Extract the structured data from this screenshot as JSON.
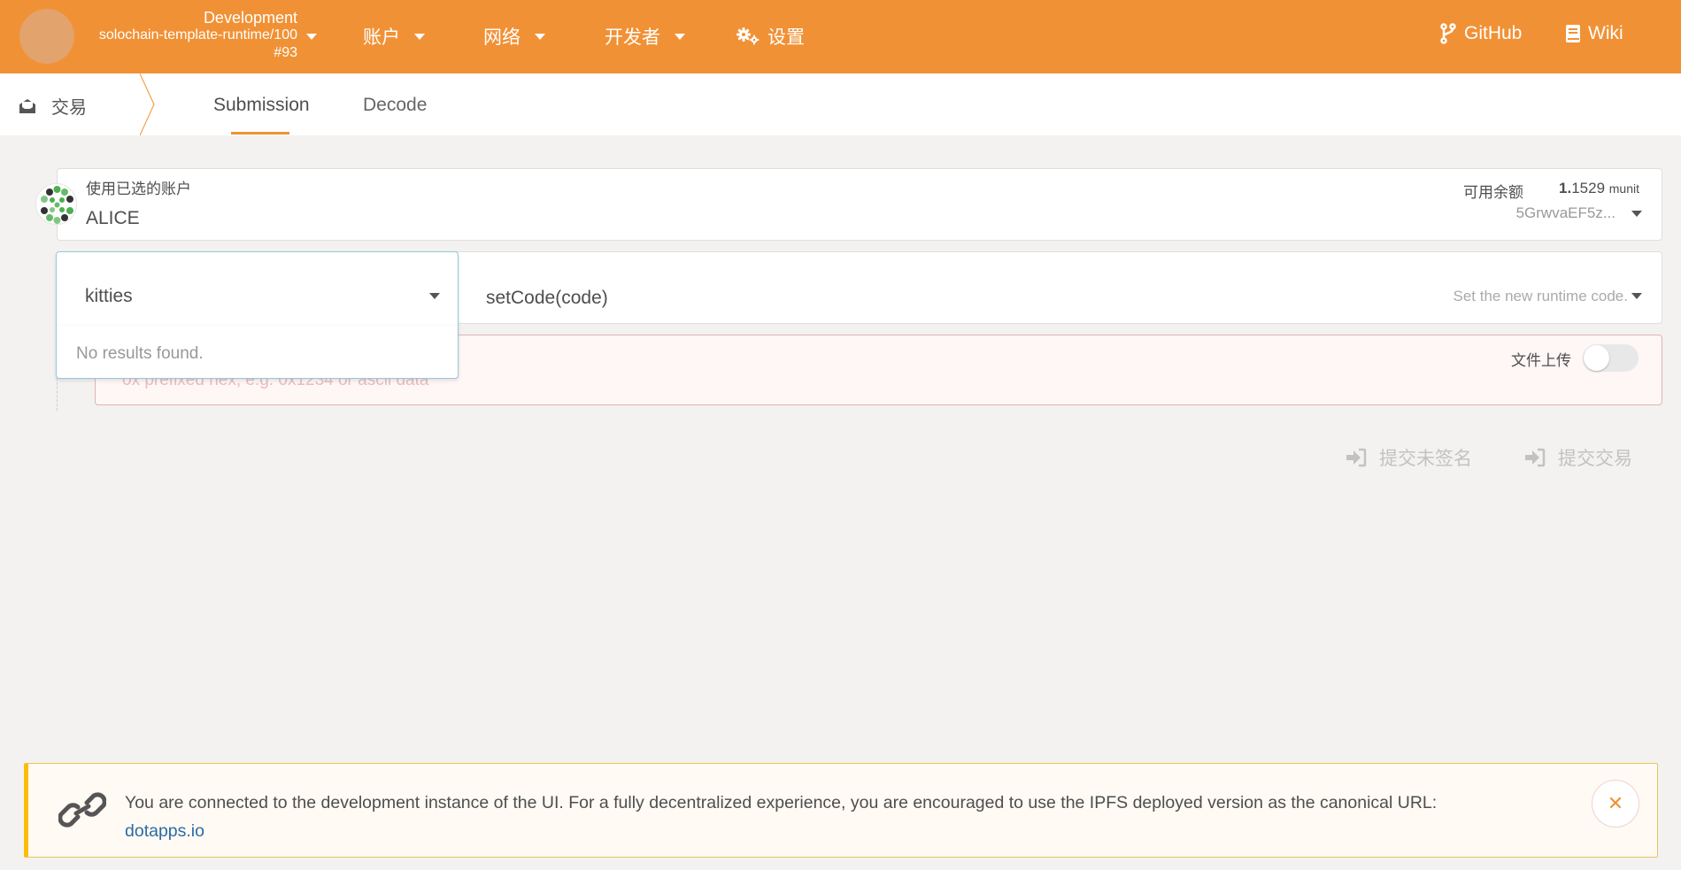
{
  "header": {
    "chain": {
      "network": "Development",
      "runtime": "solochain-template-runtime/100",
      "block": "#93"
    },
    "menu": [
      {
        "label": "账户"
      },
      {
        "label": "网络"
      },
      {
        "label": "开发者"
      },
      {
        "label": "设置"
      }
    ],
    "links": [
      {
        "label": "GitHub"
      },
      {
        "label": "Wiki"
      }
    ]
  },
  "tabbar": {
    "section": "交易",
    "tabs": [
      "Submission",
      "Decode"
    ],
    "active_tab": "Submission"
  },
  "account": {
    "label": "使用已选的账户",
    "name": "ALICE",
    "balance_label": "可用余额",
    "balance_int": "1.",
    "balance_frac": "1529",
    "balance_unit": "munit",
    "address": "5GrwvaEF5z..."
  },
  "extrinsic": {
    "module": "kitties",
    "method": "setCode(code)",
    "description": "Set the new runtime code.",
    "dropdown_empty": "No results found."
  },
  "param": {
    "placeholder": "0x prefixed hex, e.g. 0x1234 or ascii data",
    "file_upload_label": "文件上传",
    "file_upload_on": false
  },
  "actions": {
    "submit_unsigned": "提交未签名",
    "submit": "提交交易"
  },
  "notice": {
    "text": "You are connected to the development instance of the UI. For a fully decentralized experience, you are encouraged to use the IPFS deployed version as the canonical URL:",
    "link": "dotapps.io"
  },
  "colors": {
    "header": "#f19135",
    "accent": "#f19135",
    "error_bg": "#fff6f6",
    "notice_border": "#fbbd08"
  }
}
